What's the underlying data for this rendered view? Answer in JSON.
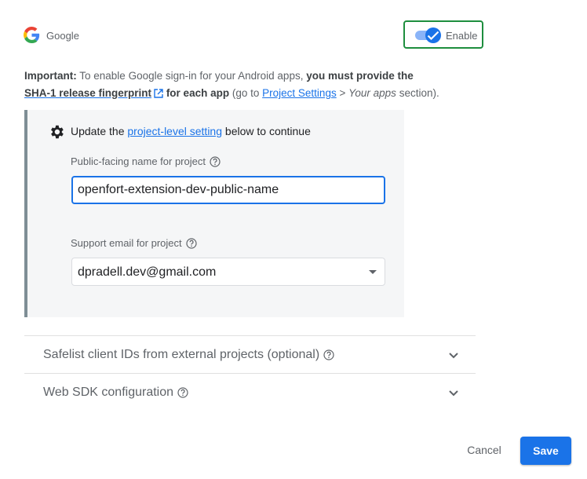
{
  "provider": {
    "name": "Google",
    "logo_icon": "google-g-icon"
  },
  "toggle": {
    "label": "Enable",
    "enabled": true,
    "accent": "#1a73e8",
    "border_color": "#1e8e3e"
  },
  "notice": {
    "important_label": "Important:",
    "text_1": "To enable Google sign-in for your Android apps,",
    "emphasis": "you must provide the",
    "link_fingerprint": "SHA-1 release fingerprint",
    "text_2": "for each app",
    "text_3": "(go to",
    "link_project_settings": "Project Settings",
    "text_4": ">",
    "italic_apps": "Your apps",
    "text_5": "section)."
  },
  "panel": {
    "title_prefix": "Update the",
    "title_link": "project-level setting",
    "title_suffix": "below to continue",
    "public_name_label": "Public-facing name for project",
    "public_name_value": "openfort-extension-dev-public-name",
    "support_email_label": "Support email for project",
    "support_email_value": "dpradell.dev@gmail.com"
  },
  "accordions": [
    {
      "label": "Safelist client IDs from external projects (optional)"
    },
    {
      "label": "Web SDK configuration"
    }
  ],
  "footer": {
    "cancel_label": "Cancel",
    "save_label": "Save",
    "save_color": "#1a73e8"
  }
}
